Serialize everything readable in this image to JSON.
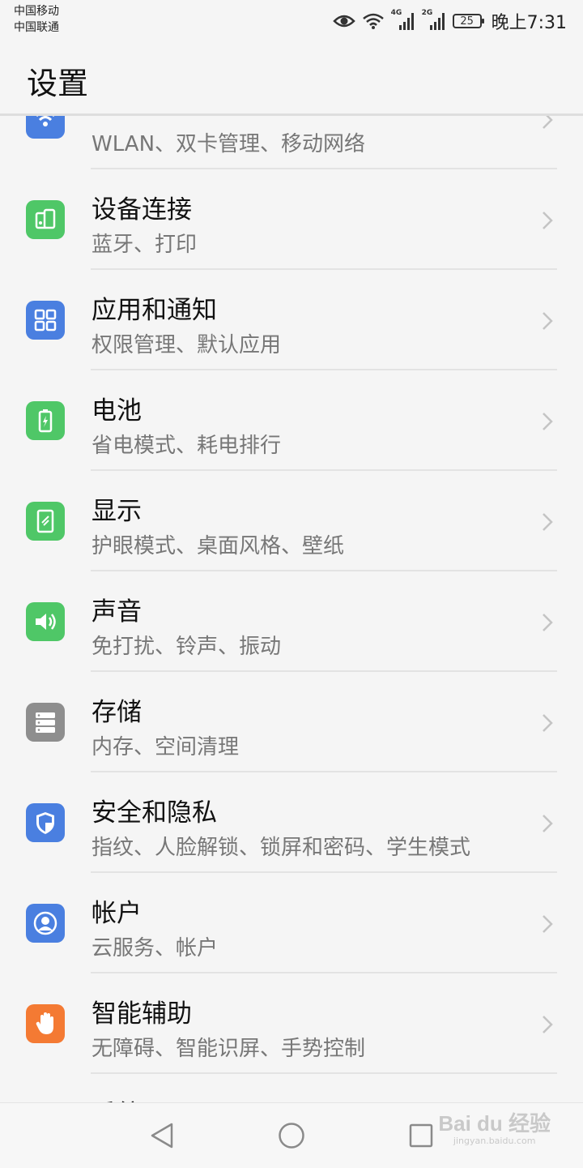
{
  "status_bar": {
    "carrier_1": "中国移动",
    "carrier_2": "中国联通",
    "net_1": "4G",
    "net_2": "2G",
    "battery": "25",
    "time": "晚上7:31"
  },
  "header": {
    "title": "设置"
  },
  "settings_items": [
    {
      "title": "",
      "subtitle": "WLAN、双卡管理、移动网络",
      "icon": "wifi-icon",
      "color": "#4a7fe0"
    },
    {
      "title": "设备连接",
      "subtitle": "蓝牙、打印",
      "icon": "device-connection-icon",
      "color": "#4fc767"
    },
    {
      "title": "应用和通知",
      "subtitle": "权限管理、默认应用",
      "icon": "apps-icon",
      "color": "#4a7fe0"
    },
    {
      "title": "电池",
      "subtitle": "省电模式、耗电排行",
      "icon": "battery-icon",
      "color": "#4fc767"
    },
    {
      "title": "显示",
      "subtitle": "护眼模式、桌面风格、壁纸",
      "icon": "display-icon",
      "color": "#4fc767"
    },
    {
      "title": "声音",
      "subtitle": "免打扰、铃声、振动",
      "icon": "sound-icon",
      "color": "#4fc767"
    },
    {
      "title": "存储",
      "subtitle": "内存、空间清理",
      "icon": "storage-icon",
      "color": "#8e8e8e"
    },
    {
      "title": "安全和隐私",
      "subtitle": "指纹、人脸解锁、锁屏和密码、学生模式",
      "icon": "shield-icon",
      "color": "#4a7fe0"
    },
    {
      "title": "帐户",
      "subtitle": "云服务、帐户",
      "icon": "account-icon",
      "color": "#4a7fe0"
    },
    {
      "title": "智能辅助",
      "subtitle": "无障碍、智能识屏、手势控制",
      "icon": "hand-icon",
      "color": "#f47a33"
    },
    {
      "title": "系统",
      "subtitle": "",
      "icon": "system-icon",
      "color": "#8e8e8e"
    }
  ],
  "watermark": {
    "main": "Bai du 经验",
    "sub": "jingyan.baidu.com"
  }
}
